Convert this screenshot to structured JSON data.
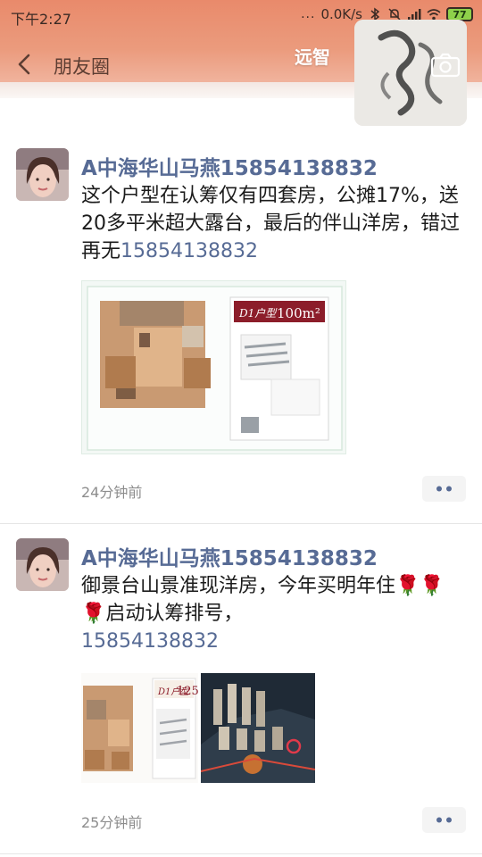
{
  "status_bar": {
    "time": "下午2:27",
    "more_dots": "...",
    "network_speed": "0.0K/s",
    "battery": "77"
  },
  "nav": {
    "title": "朋友圈"
  },
  "self": {
    "name": "远智"
  },
  "posts": [
    {
      "name": "A中海华山马燕15854138832",
      "text": "这个户型在认筹仅有四套房，公摊17%，送20多平米超大露台，最后的伴山洋房，错过再无",
      "phone": "15854138832",
      "floorplan_label": "D1户型",
      "floorplan_area": "100m²",
      "time": "24分钟前"
    },
    {
      "name": "A中海华山马燕15854138832",
      "text": "御景台山景准现洋房，今年买明年住🌹🌹🌹启动认筹排号，",
      "phone": "15854138832",
      "floorplan_area": "125",
      "time": "25分钟前"
    }
  ],
  "colors": {
    "header_accent": "#e98a6b",
    "link_blue": "#576b95",
    "timestamp_gray": "#8d8d8d"
  },
  "icons": {
    "back": "chevron-left-icon",
    "camera": "camera-icon",
    "more": "more-dots-icon",
    "bluetooth": "bluetooth-icon",
    "mute": "bell-mute-icon",
    "signal": "signal-icon",
    "wifi": "wifi-icon"
  }
}
